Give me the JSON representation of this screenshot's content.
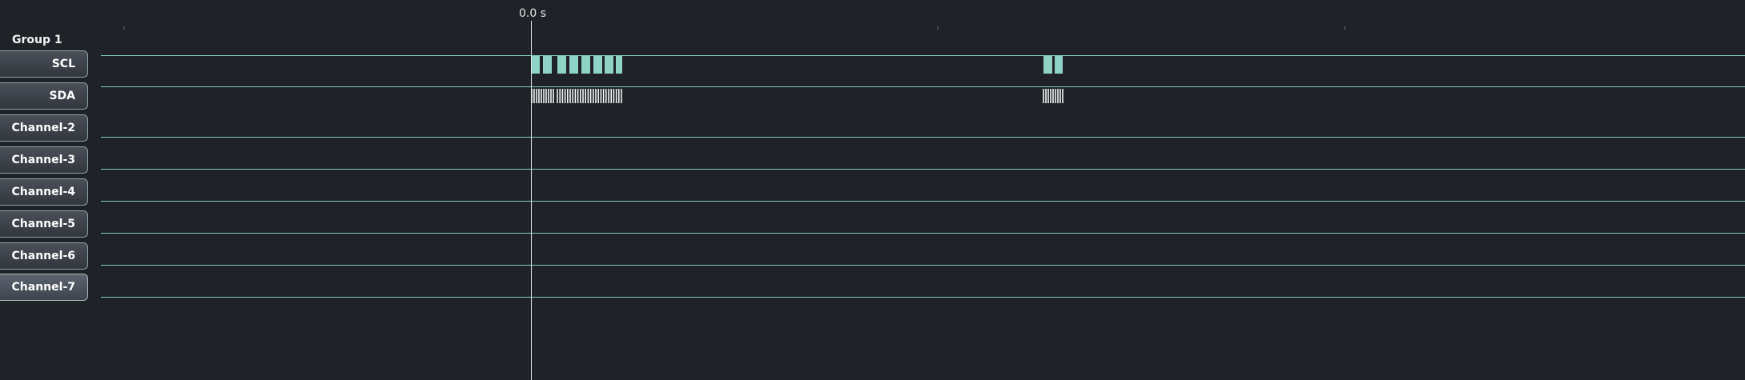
{
  "timeline": {
    "cursor_label": "0.0 s"
  },
  "group": {
    "label": "Group 1"
  },
  "channels": [
    {
      "label": "SCL"
    },
    {
      "label": "SDA"
    },
    {
      "label": "Channel-2"
    },
    {
      "label": "Channel-3"
    },
    {
      "label": "Channel-4"
    },
    {
      "label": "Channel-5"
    },
    {
      "label": "Channel-6"
    },
    {
      "label": "Channel-7"
    }
  ],
  "colors": {
    "background": "#1f2227",
    "signal": "#8fd3c7",
    "signal_line": "#7fcfc6",
    "sda_burst": "#ffffff",
    "cursor": "#e6e8ea"
  }
}
